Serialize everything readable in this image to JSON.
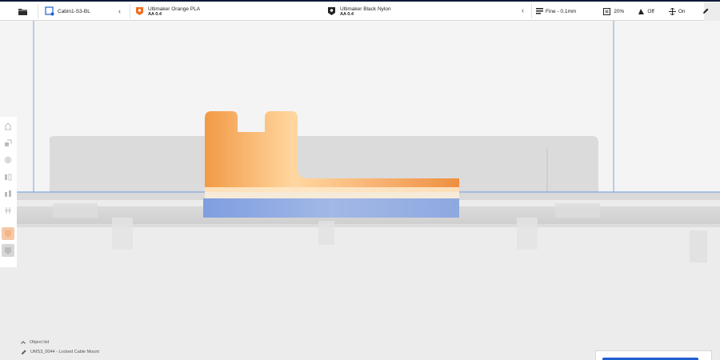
{
  "toolbar": {
    "printer_name": "Cabin1-S3-BL",
    "extruder1": {
      "material": "Ultimaker Orange PLA",
      "core": "AA 0.4",
      "color": "#f06c1e"
    },
    "extruder2": {
      "material": "Ultimaker Black Nylon",
      "core": "AA 0.4",
      "color": "#222222"
    },
    "print_settings": {
      "profile": "Fine - 0.1mm",
      "infill": "20%",
      "support": "Off",
      "adhesion": "On"
    }
  },
  "object_list": {
    "header": "Object list",
    "current_object": "UMS3_0044 - Locked Cable Mount"
  },
  "colors": {
    "model_orange": "#f5a05a",
    "buildplate_blue": "#4a6fd8",
    "accent_blue": "#1f5fd1"
  }
}
